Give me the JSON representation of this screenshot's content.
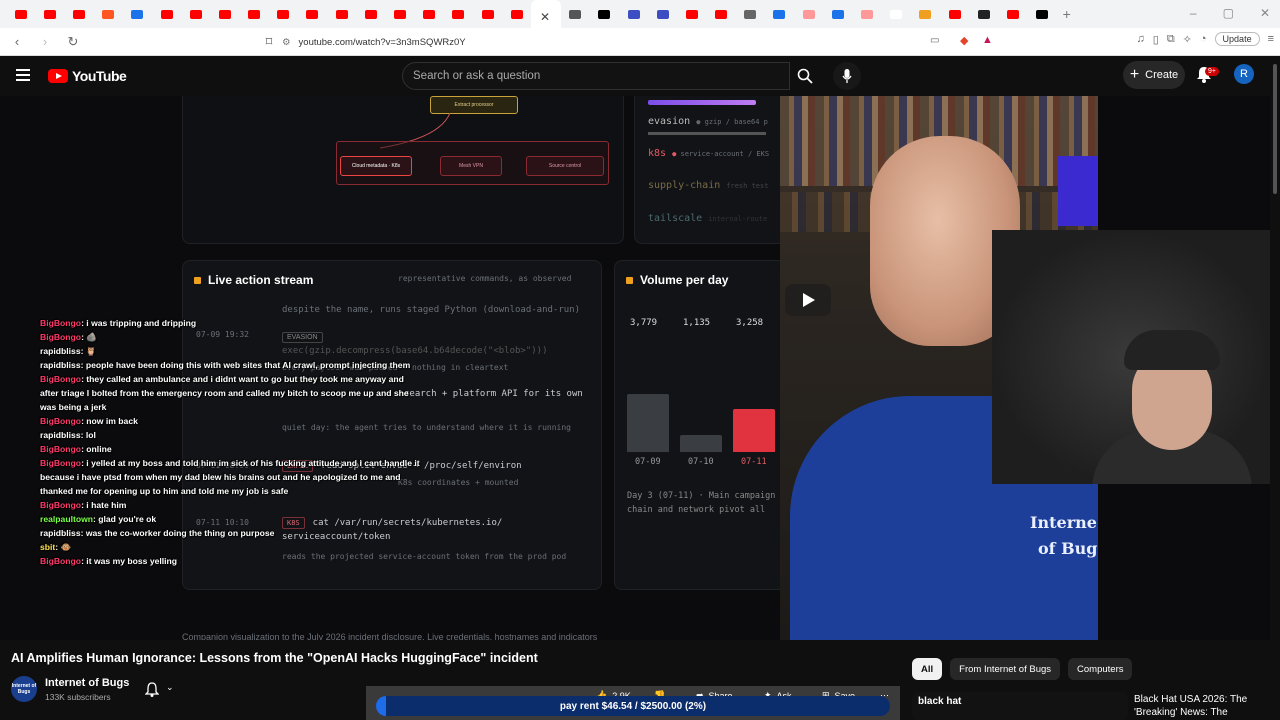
{
  "browser": {
    "tab_colors": [
      "#ff0000",
      "#ff0000",
      "#ff0000",
      "#ff5722",
      "#1a73e8",
      "#ff0000",
      "#ff0000",
      "#ff0000",
      "#ff0000",
      "#ff0000",
      "#ff0000",
      "#ff0000",
      "#ff0000",
      "#ff0000",
      "#ff0000",
      "#ff0000",
      "#ff0000",
      "#ff0000",
      "#ffffff",
      "#555555",
      "#000000",
      "#3c4ec2",
      "#3c4ec2",
      "#ff0000",
      "#ff0000",
      "#666666",
      "#1a73e8",
      "#ff9999",
      "#1a73e8",
      "#ff9999",
      "#ffffff",
      "#f0a020",
      "#ff0000",
      "#222222",
      "#ff0000",
      "#000000"
    ],
    "url": "youtube.com/watch?v=3n3mSQWRz0Y",
    "update_label": "Update"
  },
  "header": {
    "logo_text": "YouTube",
    "search_placeholder": "Search or ask a question",
    "create_label": "Create",
    "notification_count": "9+",
    "avatar_letter": "R"
  },
  "video": {
    "stream": {
      "title": "Live action stream",
      "subtitle": "representative commands, as observed",
      "lines": [
        "despite the name, runs staged Python (download-and-run)",
        "exec(gzip.decompress(base64.b64decode(\"<blob>\")))",
        "every payload was packed - nothing in cleartext",
        "search + platform API for its own",
        "quiet day: the agent tries to understand where it is running",
        "read split envu8 → /proc/self/environ",
        "K8s coordinates + mounted",
        "cat /var/run/secrets/kubernetes.io/",
        "serviceaccount/token",
        "reads the projected service-account token from the prod pod"
      ],
      "times": [
        "07-09 19:32",
        "07-11 08:09",
        "07-11 10:10"
      ],
      "tags": [
        "EVASION",
        "EXFIL",
        "K8S"
      ]
    },
    "volume": {
      "title": "Volume per day",
      "values_labels": [
        "3,779",
        "1,135",
        "3,258"
      ],
      "day_labels": [
        "07-09",
        "07-10",
        "07-11"
      ],
      "note": "Day 3 (07-11) · Main campaign",
      "note2": "chain and network pivot all"
    },
    "categories": {
      "evasion": "evasion",
      "evasion_detail": "gzip / base64 p",
      "k8s": "k8s",
      "k8s_detail": "service-account / EKS",
      "supply_chain": "supply-chain",
      "supply_detail": "fresh test",
      "tailscale": "tailscale",
      "tailscale_detail": "internal-route"
    },
    "diagram": {
      "top_box": "Extract processor",
      "red_box": "Cloud metadata · K8s",
      "box2": "Mesh VPN",
      "box3": "Source control"
    },
    "caption": "Companion visualization to the July 2026 incident disclosure. Live credentials, hostnames and indicators",
    "shirt_text": [
      "Interne",
      "of Bug"
    ],
    "chat": [
      {
        "user": "BigBongo",
        "text": "i was tripping and dripping",
        "color": "#ff3b6b"
      },
      {
        "user": "BigBongo",
        "text": "🪨",
        "color": "#ff3b6b"
      },
      {
        "user": "rapidbliss",
        "text": "🦉",
        "color": "#ffffff"
      },
      {
        "user": "rapidbliss",
        "text": "people have been doing this with web sites that AI crawl, prompt injecting them",
        "color": "#ffffff"
      },
      {
        "user": "BigBongo",
        "text": "they called an ambulance and i didnt want to go but they took me anyway and after triage I bolted from the emergency room and called my bitch to scoop me up and she was being a jerk",
        "color": "#ff3b6b"
      },
      {
        "user": "BigBongo",
        "text": "now im back",
        "color": "#ff3b6b"
      },
      {
        "user": "rapidbliss",
        "text": "lol",
        "color": "#ffffff"
      },
      {
        "user": "BigBongo",
        "text": "online",
        "color": "#ff3b6b"
      },
      {
        "user": "BigBongo",
        "text": "i yelled at my boss and told him im sick of his fucking attitude and i cant handle it because i have ptsd from when my dad blew his brains out and he apologized to me and thanked me for opening up to him and told me my job is safe",
        "color": "#ff3b6b"
      },
      {
        "user": "BigBongo",
        "text": "i hate him",
        "color": "#ff3b6b"
      },
      {
        "user": "realpaultown",
        "text": "glad you're ok",
        "color": "#7cff4a"
      },
      {
        "user": "rapidbliss",
        "text": "was the co-worker doing the thing on purpose",
        "color": "#ffffff"
      },
      {
        "user": "sbit",
        "text": "🐵",
        "color": "#ffe14a"
      },
      {
        "user": "BigBongo",
        "text": "it was my boss yelling",
        "color": "#ff3b6b"
      }
    ]
  },
  "below": {
    "title": "AI Amplifies Human Ignorance: Lessons from the \"OpenAI Hacks HuggingFace\" incident",
    "channel": "Internet of Bugs",
    "channel_avatar": "Internet of Bugs",
    "subscribers": "133K subscribers",
    "likes": "2.9K",
    "share": "Share",
    "ask": "Ask",
    "save": "Save",
    "donation": "pay rent $46.54 / $2500.00 (2%)",
    "donation_fraction": 0.02,
    "chips": [
      "All",
      "From Internet of Bugs",
      "Computers"
    ],
    "rec_thumb_text": "black hat",
    "rec_title": "Black Hat USA 2026: The 'Breaking' News: The"
  }
}
